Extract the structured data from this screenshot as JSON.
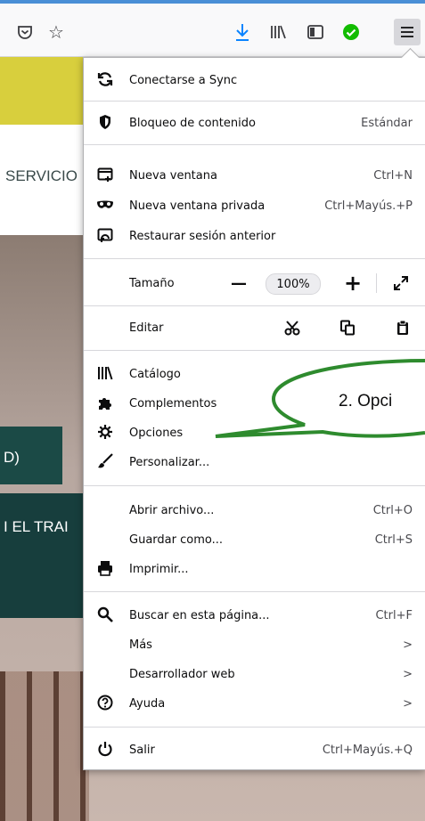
{
  "toolbar": {
    "icons": [
      "pocket-icon",
      "star-icon",
      "download-icon",
      "library-icon",
      "sidebar-icon",
      "sync-check-icon",
      "hamburger-menu-icon"
    ]
  },
  "page": {
    "servicio_text": "SERVICIO",
    "green_box_text": "D)",
    "teal_band_text": "I EL TRAI"
  },
  "menu": {
    "sync": "Conectarse a Sync",
    "content_blocking": "Bloqueo de contenido",
    "content_blocking_value": "Estándar",
    "new_window": "Nueva ventana",
    "new_window_sc": "Ctrl+N",
    "private_window": "Nueva ventana privada",
    "private_window_sc": "Ctrl+Mayús.+P",
    "restore": "Restaurar sesión anterior",
    "zoom_label": "Tamaño",
    "zoom_minus": "—",
    "zoom_value": "100%",
    "zoom_plus": "+",
    "edit_label": "Editar",
    "library": "Catálogo",
    "addons": "Complementos",
    "options": "Opciones",
    "customize": "Personalizar...",
    "open_file": "Abrir archivo...",
    "open_file_sc": "Ctrl+O",
    "save_as": "Guardar como...",
    "save_as_sc": "Ctrl+S",
    "print": "Imprimir...",
    "find": "Buscar en esta página...",
    "find_sc": "Ctrl+F",
    "more": "Más",
    "web_dev": "Desarrollador web",
    "help": "Ayuda",
    "quit": "Salir",
    "quit_sc": "Ctrl+Mayús.+Q",
    "arrow": ">"
  },
  "callout": {
    "text": "2. Opci",
    "color": "#2e8b2e"
  },
  "colors": {
    "accent_blue": "#0a84ff",
    "sync_green": "#12bc00",
    "banner_yellow": "#d8cf3d",
    "teal": "#173e3d"
  }
}
